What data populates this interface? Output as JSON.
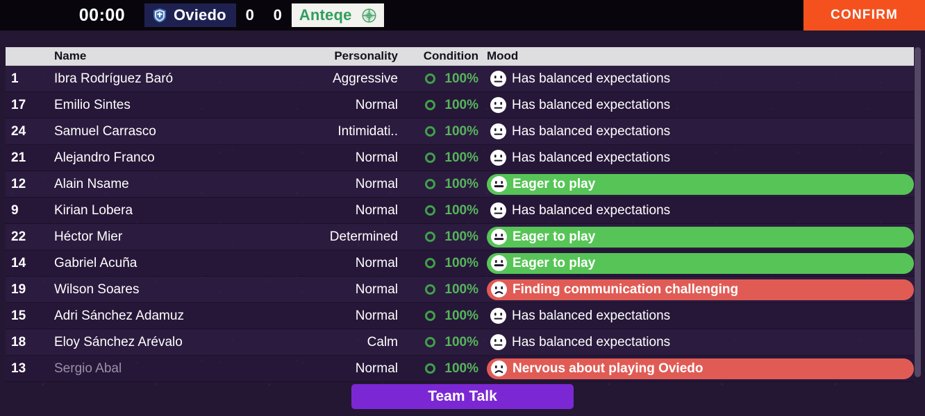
{
  "topbar": {
    "clock": "00:00",
    "home_team": {
      "name": "Oviedo",
      "crest": "shield-crest-icon",
      "score": "0"
    },
    "away_team": {
      "name": "Anteqe",
      "crest": "circle-crest-icon",
      "score": "0"
    },
    "confirm_label": "CONFIRM",
    "confirm_color": "#f4511e"
  },
  "table": {
    "headers": {
      "number": "",
      "name": "Name",
      "personality": "Personality",
      "condition": "Condition",
      "mood": "Mood"
    },
    "rows": [
      {
        "number": "1",
        "name": "Ibra Rodríguez Baró",
        "personality": "Aggressive",
        "condition": "100%",
        "mood": "Has balanced expectations",
        "mood_state": "plain",
        "face": "neutral-face-icon",
        "dim": false
      },
      {
        "number": "17",
        "name": "Emilio Sintes",
        "personality": "Normal",
        "condition": "100%",
        "mood": "Has balanced expectations",
        "mood_state": "plain",
        "face": "neutral-face-icon",
        "dim": false
      },
      {
        "number": "24",
        "name": "Samuel Carrasco",
        "personality": "Intimidati..",
        "condition": "100%",
        "mood": "Has balanced expectations",
        "mood_state": "plain",
        "face": "neutral-face-icon",
        "dim": false
      },
      {
        "number": "21",
        "name": "Alejandro Franco",
        "personality": "Normal",
        "condition": "100%",
        "mood": "Has balanced expectations",
        "mood_state": "plain",
        "face": "neutral-face-icon",
        "dim": false
      },
      {
        "number": "12",
        "name": "Alain Nsame",
        "personality": "Normal",
        "condition": "100%",
        "mood": "Eager to play",
        "mood_state": "good",
        "face": "happy-face-icon",
        "dim": false
      },
      {
        "number": "9",
        "name": "Kirian Lobera",
        "personality": "Normal",
        "condition": "100%",
        "mood": "Has balanced expectations",
        "mood_state": "plain",
        "face": "neutral-face-icon",
        "dim": false
      },
      {
        "number": "22",
        "name": "Héctor Mier",
        "personality": "Determined",
        "condition": "100%",
        "mood": "Eager to play",
        "mood_state": "good",
        "face": "happy-face-icon",
        "dim": false
      },
      {
        "number": "14",
        "name": "Gabriel Acuña",
        "personality": "Normal",
        "condition": "100%",
        "mood": "Eager to play",
        "mood_state": "good",
        "face": "happy-face-icon",
        "dim": false
      },
      {
        "number": "19",
        "name": "Wilson Soares",
        "personality": "Normal",
        "condition": "100%",
        "mood": "Finding communication challenging",
        "mood_state": "bad",
        "face": "sad-face-icon",
        "dim": false
      },
      {
        "number": "15",
        "name": "Adri Sánchez Adamuz",
        "personality": "Normal",
        "condition": "100%",
        "mood": "Has balanced expectations",
        "mood_state": "plain",
        "face": "neutral-face-icon",
        "dim": false
      },
      {
        "number": "18",
        "name": "Eloy Sánchez Arévalo",
        "personality": "Calm",
        "condition": "100%",
        "mood": "Has balanced expectations",
        "mood_state": "plain",
        "face": "neutral-face-icon",
        "dim": false
      },
      {
        "number": "13",
        "name": "Sergio Abal",
        "personality": "Normal",
        "condition": "100%",
        "mood": "Nervous about playing Oviedo",
        "mood_state": "bad",
        "face": "sad-face-icon",
        "dim": true
      }
    ]
  },
  "footer": {
    "team_talk_label": "Team Talk",
    "team_talk_color": "#7b28d4"
  },
  "colors": {
    "mood_good": "#57c457",
    "mood_bad": "#e15b55",
    "condition_green": "#56b45c",
    "background": "#241733"
  }
}
